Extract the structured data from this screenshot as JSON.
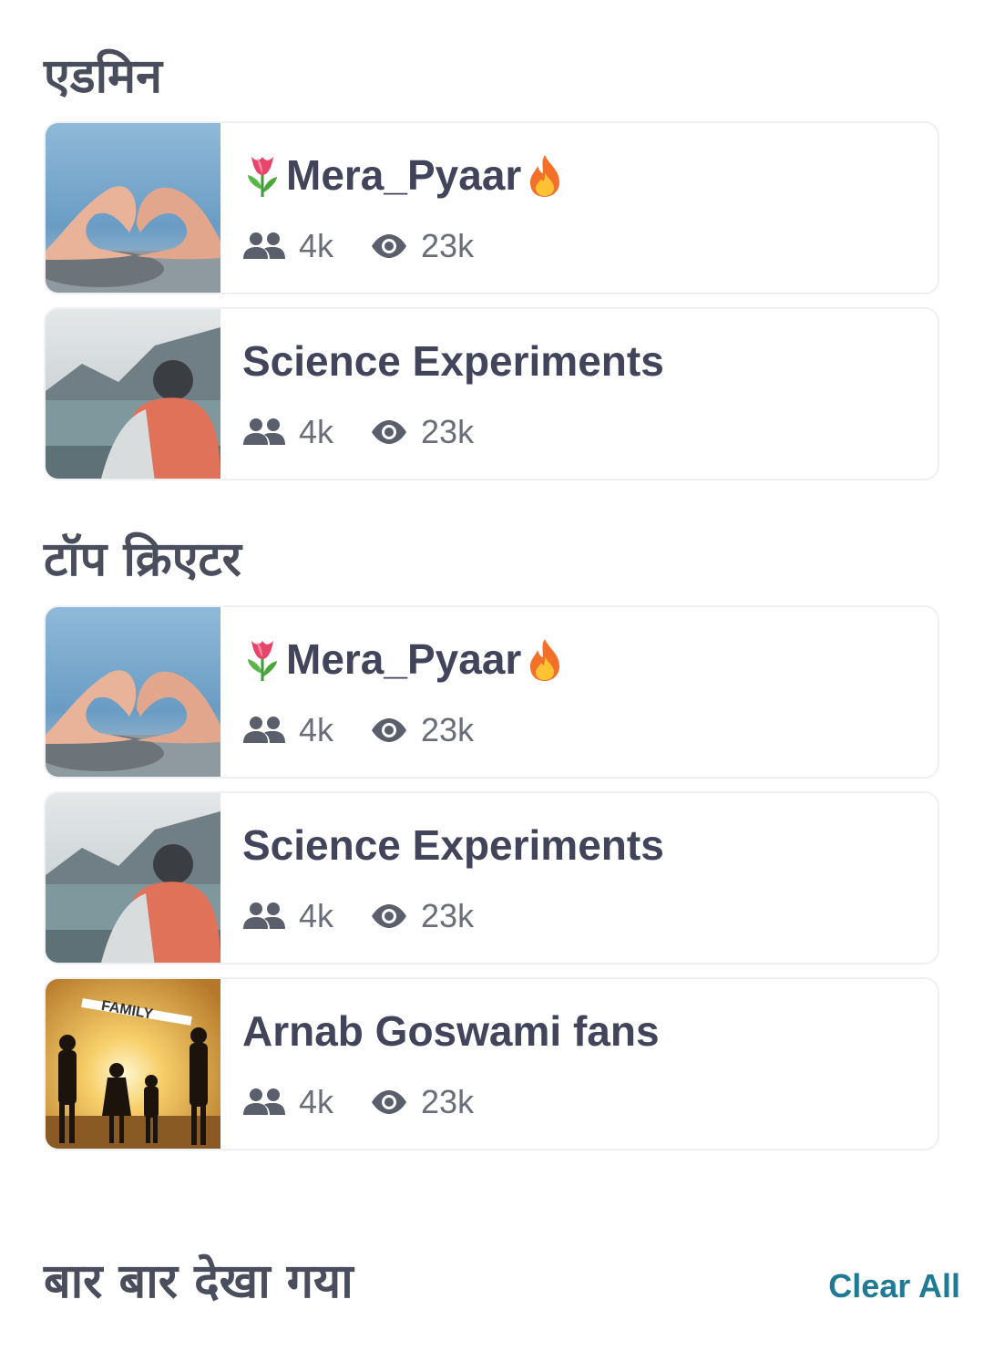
{
  "sections": [
    {
      "title": "एडमिन"
    },
    {
      "title": "टॉप क्रिएटर"
    },
    {
      "title": "बार बार देखा गया",
      "action_label": "Clear All"
    }
  ],
  "cards": [
    {
      "name": "Mera_Pyaar",
      "prefix_emoji": "tulip",
      "suffix_emoji": "fire",
      "members": "4k",
      "views": "23k",
      "thumbnail": "heart-hands"
    },
    {
      "name": "Science Experiments",
      "members": "4k",
      "views": "23k",
      "thumbnail": "hiker-lake"
    },
    {
      "name": "Mera_Pyaar",
      "prefix_emoji": "tulip",
      "suffix_emoji": "fire",
      "members": "4k",
      "views": "23k",
      "thumbnail": "heart-hands"
    },
    {
      "name": "Science Experiments",
      "members": "4k",
      "views": "23k",
      "thumbnail": "hiker-lake"
    },
    {
      "name": "Arnab Goswami fans",
      "members": "4k",
      "views": "23k",
      "thumbnail": "family-sunset",
      "thumbnail_text": "FAMILY"
    }
  ],
  "colors": {
    "accent": "#1f7a96",
    "title": "#4a4d5c",
    "muted": "#6a6d7a"
  }
}
